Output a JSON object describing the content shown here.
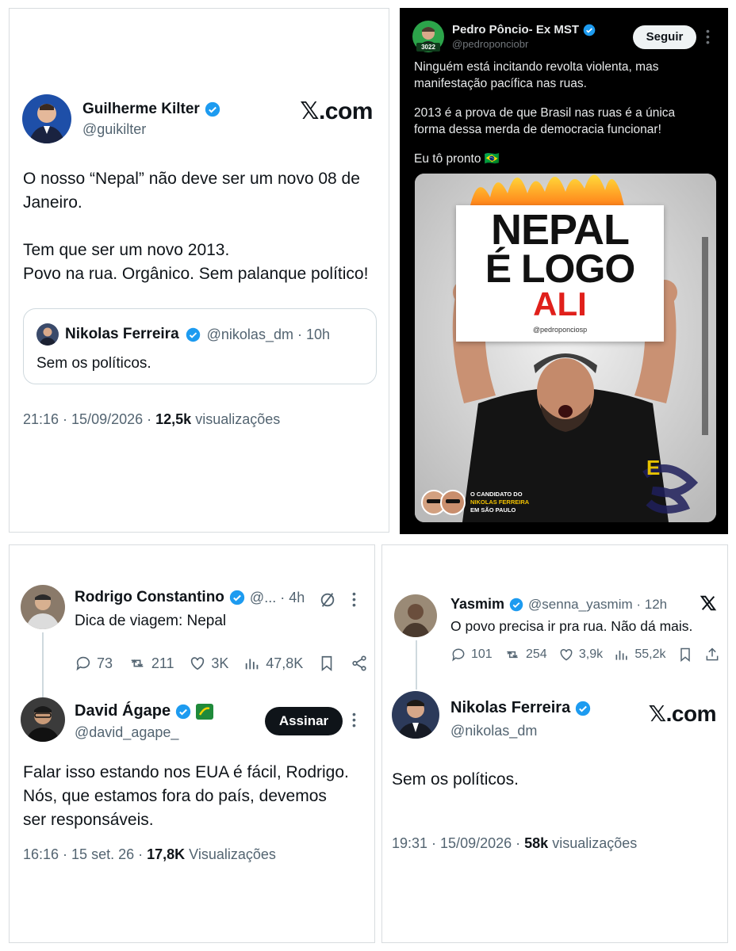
{
  "tweet1": {
    "name": "Guilherme Kilter",
    "handle": "@guikilter",
    "brand": "𝕏.com",
    "text_line1": "O nosso “Nepal” não deve ser um novo 08 de",
    "text_line2": "Janeiro.",
    "text_line3": "Tem que ser um novo 2013.",
    "text_line4": "Povo na rua. Orgânico. Sem palanque político!",
    "quote": {
      "name": "Nikolas Ferreira",
      "meta": "@nikolas_dm · 10h",
      "text": "Sem os políticos."
    },
    "time": "21:16 · 15/09/2026 ·",
    "views_count": "12,5k",
    "views_label": "visualizações"
  },
  "tweet2": {
    "name": "Pedro Pôncio- Ex MST",
    "handle": "@pedroponciobr",
    "avatar_badge": "3022",
    "follow_label": "Seguir",
    "text_line1": "Ninguém está incitando revolta violenta, mas",
    "text_line2": "manifestação pacífica nas ruas.",
    "text_line3": "2013 é a prova de que Brasil nas ruas é a única",
    "text_line4": "forma dessa merda de democracia funcionar!",
    "text_line5": "Eu tô pronto 🇧🇷",
    "poster": {
      "line1": "NEPAL",
      "line2": "É LOGO",
      "line3": "ALI",
      "sign_handle": "@pedroponciosp",
      "caption_line1": "O CANDIDATO DO",
      "caption_line2": "NIKOLAS FERREIRA",
      "caption_line3": "EM SÃO PAULO"
    }
  },
  "tweet3": {
    "parent": {
      "name": "Rodrigo Constantino",
      "meta": "@... · 4h",
      "text": "Dica de viagem: Nepal",
      "replies": "73",
      "retweets": "211",
      "likes": "3K",
      "views": "47,8K"
    },
    "reply": {
      "name": "David Ágape",
      "handle": "@david_agape_",
      "subscribe_label": "Assinar",
      "text_line1": "Falar isso estando nos EUA é fácil, Rodrigo.",
      "text_line2": "Nós, que estamos fora do país, devemos",
      "text_line3": "ser responsáveis.",
      "time": "16:16 · 15 set. 26 ·",
      "views_count": "17,8K",
      "views_label": "Visualizações"
    }
  },
  "tweet4": {
    "parent": {
      "name": "Yasmim",
      "meta": "@senna_yasmim · 12h",
      "text": "O povo precisa ir pra rua. Não dá mais.",
      "replies": "101",
      "retweets": "254",
      "likes": "3,9k",
      "views": "55,2k"
    },
    "reply": {
      "name": "Nikolas Ferreira",
      "handle": "@nikolas_dm",
      "brand": "𝕏.com",
      "text": "Sem os políticos.",
      "time": "19:31 · 15/09/2026 ·",
      "views_count": "58k",
      "views_label": "visualizações"
    }
  },
  "colors": {
    "verified": "#1d9bf0",
    "text": "#0f1419",
    "muted": "#536471",
    "dark_bg": "#000000",
    "poster_red": "#e0201b"
  }
}
